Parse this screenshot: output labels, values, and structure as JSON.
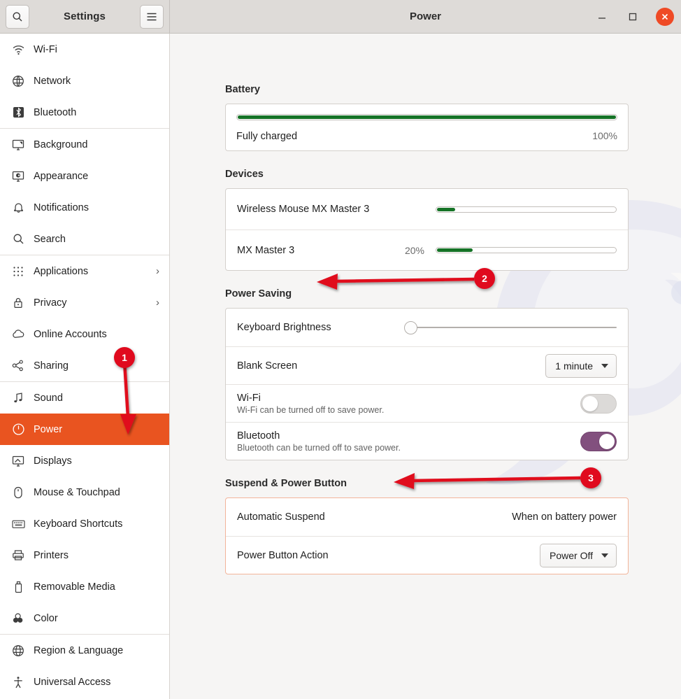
{
  "window": {
    "app_title": "Settings",
    "page_title": "Power",
    "search_icon": "search-icon",
    "menu_icon": "hamburger-menu-icon",
    "minimize_label": "–",
    "maximize_label": "□",
    "close_label": "✕",
    "accent_orange": "#e95420",
    "close_button_color": "#ef4a25",
    "annotation_red": "#e00a1e",
    "toggle_on_color": "#82507e",
    "battery_green": "#157326"
  },
  "sidebar": {
    "groups": [
      {
        "items": [
          {
            "label": "Wi-Fi",
            "icon": "wifi-icon",
            "active": false,
            "chevron": ""
          },
          {
            "label": "Network",
            "icon": "network-globe-icon",
            "active": false,
            "chevron": ""
          },
          {
            "label": "Bluetooth",
            "icon": "bluetooth-icon",
            "active": false,
            "chevron": ""
          }
        ]
      },
      {
        "items": [
          {
            "label": "Background",
            "icon": "background-icon",
            "active": false,
            "chevron": ""
          },
          {
            "label": "Appearance",
            "icon": "appearance-icon",
            "active": false,
            "chevron": ""
          },
          {
            "label": "Notifications",
            "icon": "bell-icon",
            "active": false,
            "chevron": ""
          },
          {
            "label": "Search",
            "icon": "search-icon",
            "active": false,
            "chevron": ""
          }
        ]
      },
      {
        "items": [
          {
            "label": "Applications",
            "icon": "grid-apps-icon",
            "active": false,
            "chevron": "›"
          },
          {
            "label": "Privacy",
            "icon": "lock-icon",
            "active": false,
            "chevron": "›"
          },
          {
            "label": "Online Accounts",
            "icon": "cloud-icon",
            "active": false,
            "chevron": ""
          },
          {
            "label": "Sharing",
            "icon": "share-nodes-icon",
            "active": false,
            "chevron": ""
          }
        ]
      },
      {
        "items": [
          {
            "label": "Sound",
            "icon": "music-note-icon",
            "active": false,
            "chevron": ""
          },
          {
            "label": "Power",
            "icon": "power-icon",
            "active": true,
            "chevron": ""
          },
          {
            "label": "Displays",
            "icon": "display-icon",
            "active": false,
            "chevron": ""
          },
          {
            "label": "Mouse & Touchpad",
            "icon": "mouse-icon",
            "active": false,
            "chevron": ""
          },
          {
            "label": "Keyboard Shortcuts",
            "icon": "keyboard-icon",
            "active": false,
            "chevron": ""
          },
          {
            "label": "Printers",
            "icon": "printer-icon",
            "active": false,
            "chevron": ""
          },
          {
            "label": "Removable Media",
            "icon": "usb-drive-icon",
            "active": false,
            "chevron": ""
          },
          {
            "label": "Color",
            "icon": "color-circles-icon",
            "active": false,
            "chevron": ""
          }
        ]
      },
      {
        "items": [
          {
            "label": "Region & Language",
            "icon": "globe-icon",
            "active": false,
            "chevron": ""
          },
          {
            "label": "Universal Access",
            "icon": "accessibility-icon",
            "active": false,
            "chevron": ""
          }
        ]
      }
    ]
  },
  "main": {
    "battery": {
      "section_title": "Battery",
      "status": "Fully charged",
      "percent_label": "100%",
      "percent_value": 100
    },
    "devices": {
      "section_title": "Devices",
      "rows": [
        {
          "name": "Wireless Mouse MX Master 3",
          "percent_label": "",
          "percent_value": 10
        },
        {
          "name": "MX Master 3",
          "percent_label": "20%",
          "percent_value": 20
        }
      ]
    },
    "power_saving": {
      "section_title": "Power Saving",
      "keyboard_brightness": {
        "label": "Keyboard Brightness",
        "value": 0
      },
      "blank_screen": {
        "label": "Blank Screen",
        "value": "1 minute"
      },
      "wifi": {
        "label": "Wi-Fi",
        "description": "Wi-Fi can be turned off to save power.",
        "enabled": false
      },
      "bluetooth": {
        "label": "Bluetooth",
        "description": "Bluetooth can be turned off to save power.",
        "enabled": true
      }
    },
    "suspend": {
      "section_title": "Suspend & Power Button",
      "automatic_suspend": {
        "label": "Automatic Suspend",
        "value": "When on battery power"
      },
      "power_button_action": {
        "label": "Power Button Action",
        "value": "Power Off"
      }
    }
  },
  "annotations": [
    {
      "number": "1",
      "target": "sidebar-item-power"
    },
    {
      "number": "2",
      "target": "power-saving-section-title"
    },
    {
      "number": "3",
      "target": "suspend-power-button-section-title"
    }
  ]
}
